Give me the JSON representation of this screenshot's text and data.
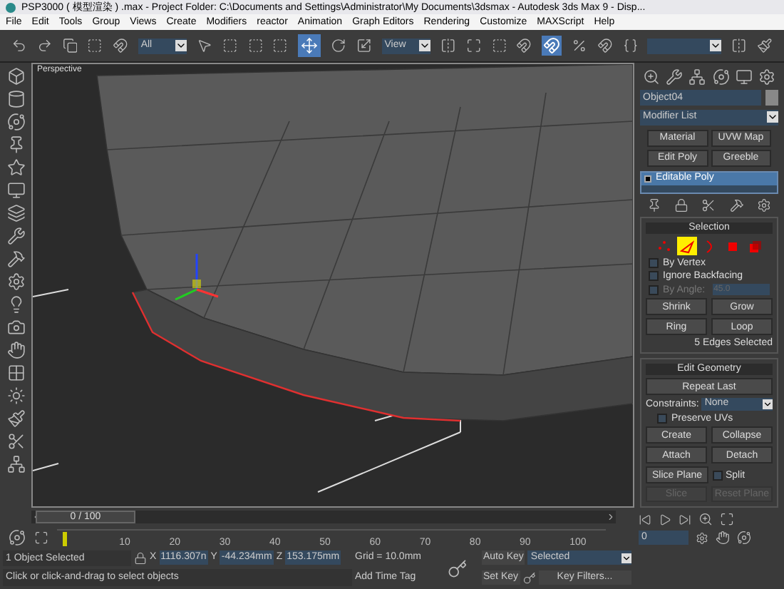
{
  "window": {
    "title": "PSP3000 ( 模型渲染 ) .max   - Project Folder: C:\\Documents and Settings\\Administrator\\My Documents\\3dsmax    - Autodesk 3ds Max 9    - Disp..."
  },
  "menu": [
    "File",
    "Edit",
    "Tools",
    "Group",
    "Views",
    "Create",
    "Modifiers",
    "reactor",
    "Animation",
    "Graph Editors",
    "Rendering",
    "Customize",
    "MAXScript",
    "Help"
  ],
  "toolbar": {
    "selection_filter": "All",
    "coordinate_system": "View",
    "move_selected": true
  },
  "viewport": {
    "label": "Perspective"
  },
  "command_panel": {
    "object_name": "Object04",
    "modifier_list": "Modifier List",
    "modifier_buttons": [
      "Material",
      "UVW Map",
      "Edit Poly",
      "Greeble"
    ],
    "stack": [
      {
        "label": "Editable Poly",
        "selected": true
      }
    ],
    "selection": {
      "title": "Selection",
      "subobjects": [
        {
          "kind": "vertex",
          "selected": false
        },
        {
          "kind": "edge",
          "selected": true
        },
        {
          "kind": "border",
          "selected": false
        },
        {
          "kind": "polygon",
          "selected": false
        },
        {
          "kind": "element",
          "selected": false
        }
      ],
      "options": [
        {
          "label": "By Vertex",
          "checked": false,
          "disabled": false
        },
        {
          "label": "Ignore Backfacing",
          "checked": false,
          "disabled": false
        },
        {
          "label": "By Angle:",
          "checked": false,
          "disabled": true
        }
      ],
      "angle": "45.0",
      "buttons": [
        "Shrink",
        "Grow"
      ],
      "spinner_buttons": [
        "Ring",
        "Loop"
      ],
      "status": "5 Edges Selected"
    },
    "edit_geometry": {
      "title": "Edit Geometry",
      "repeat": "Repeat Last",
      "constraints_label": "Constraints:",
      "constraints": "None",
      "preserve_uvs": {
        "label": "Preserve UVs",
        "checked": false
      },
      "buttons": [
        "Create",
        "Collapse"
      ],
      "attach": "Attach",
      "detach": "Detach",
      "slice_plane": "Slice Plane",
      "split": {
        "label": "Split",
        "checked": false
      },
      "disabled_buttons": [
        "Slice",
        "Reset Plane"
      ]
    }
  },
  "time_slider": {
    "label": "0 / 100",
    "level": 0
  },
  "track_bar": {
    "labels": [
      "10",
      "20",
      "30",
      "40",
      "50",
      "60",
      "70",
      "80",
      "90",
      "100"
    ]
  },
  "status_bar": {
    "selection": "1 Object Selected",
    "axis_labels": [
      "X",
      "Y",
      "Z"
    ],
    "x": "1116.307n",
    "y": "-44.234mm",
    "z": "153.175mm",
    "grid": "Grid = 10.0mm",
    "prompt": "Click or click-and-drag to select objects",
    "time_tag": "Add Time Tag",
    "auto_key": "Auto Key",
    "key_mode": "Selected",
    "set_key": "Set Key",
    "key_filters": "Key Filters...",
    "frame": "0"
  }
}
